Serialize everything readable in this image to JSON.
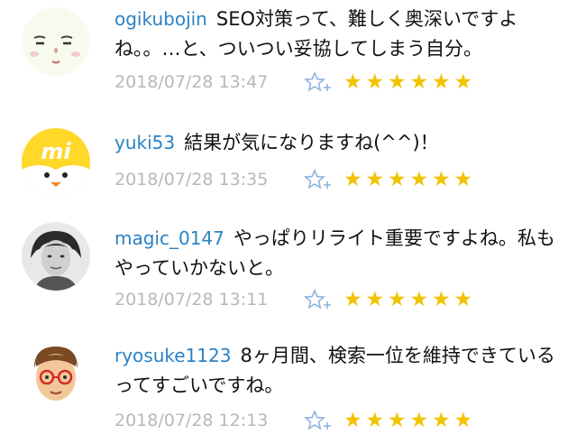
{
  "comments": [
    {
      "username": "ogikubojin",
      "text": "SEO対策って、難しく奥深いですよね。。…と、ついつい妥協してしまう自分。",
      "timestamp": "2018/07/28 13:47",
      "avatar_icon": "face-illustration-icon",
      "star_count": 6
    },
    {
      "username": "yuki53",
      "text": "結果が気になりますね(^^)！",
      "timestamp": "2018/07/28 13:35",
      "avatar_icon": "mi-chick-icon",
      "star_count": 6
    },
    {
      "username": "magic_0147",
      "text": "やっぱりリライト重要ですよね。私もやっていかないと。",
      "timestamp": "2018/07/28 13:11",
      "avatar_icon": "monochrome-portrait-icon",
      "star_count": 6
    },
    {
      "username": "ryosuke1123",
      "text": "8ヶ月間、検索一位を維持できているってすごいですね。",
      "timestamp": "2018/07/28 12:13",
      "avatar_icon": "glasses-boy-icon",
      "star_count": 6
    }
  ],
  "star_glyph": "★",
  "colors": {
    "username": "#2b82c4",
    "timestamp": "#b8b8b8",
    "star": "#f2c300",
    "add_star": "#8fb4de"
  }
}
